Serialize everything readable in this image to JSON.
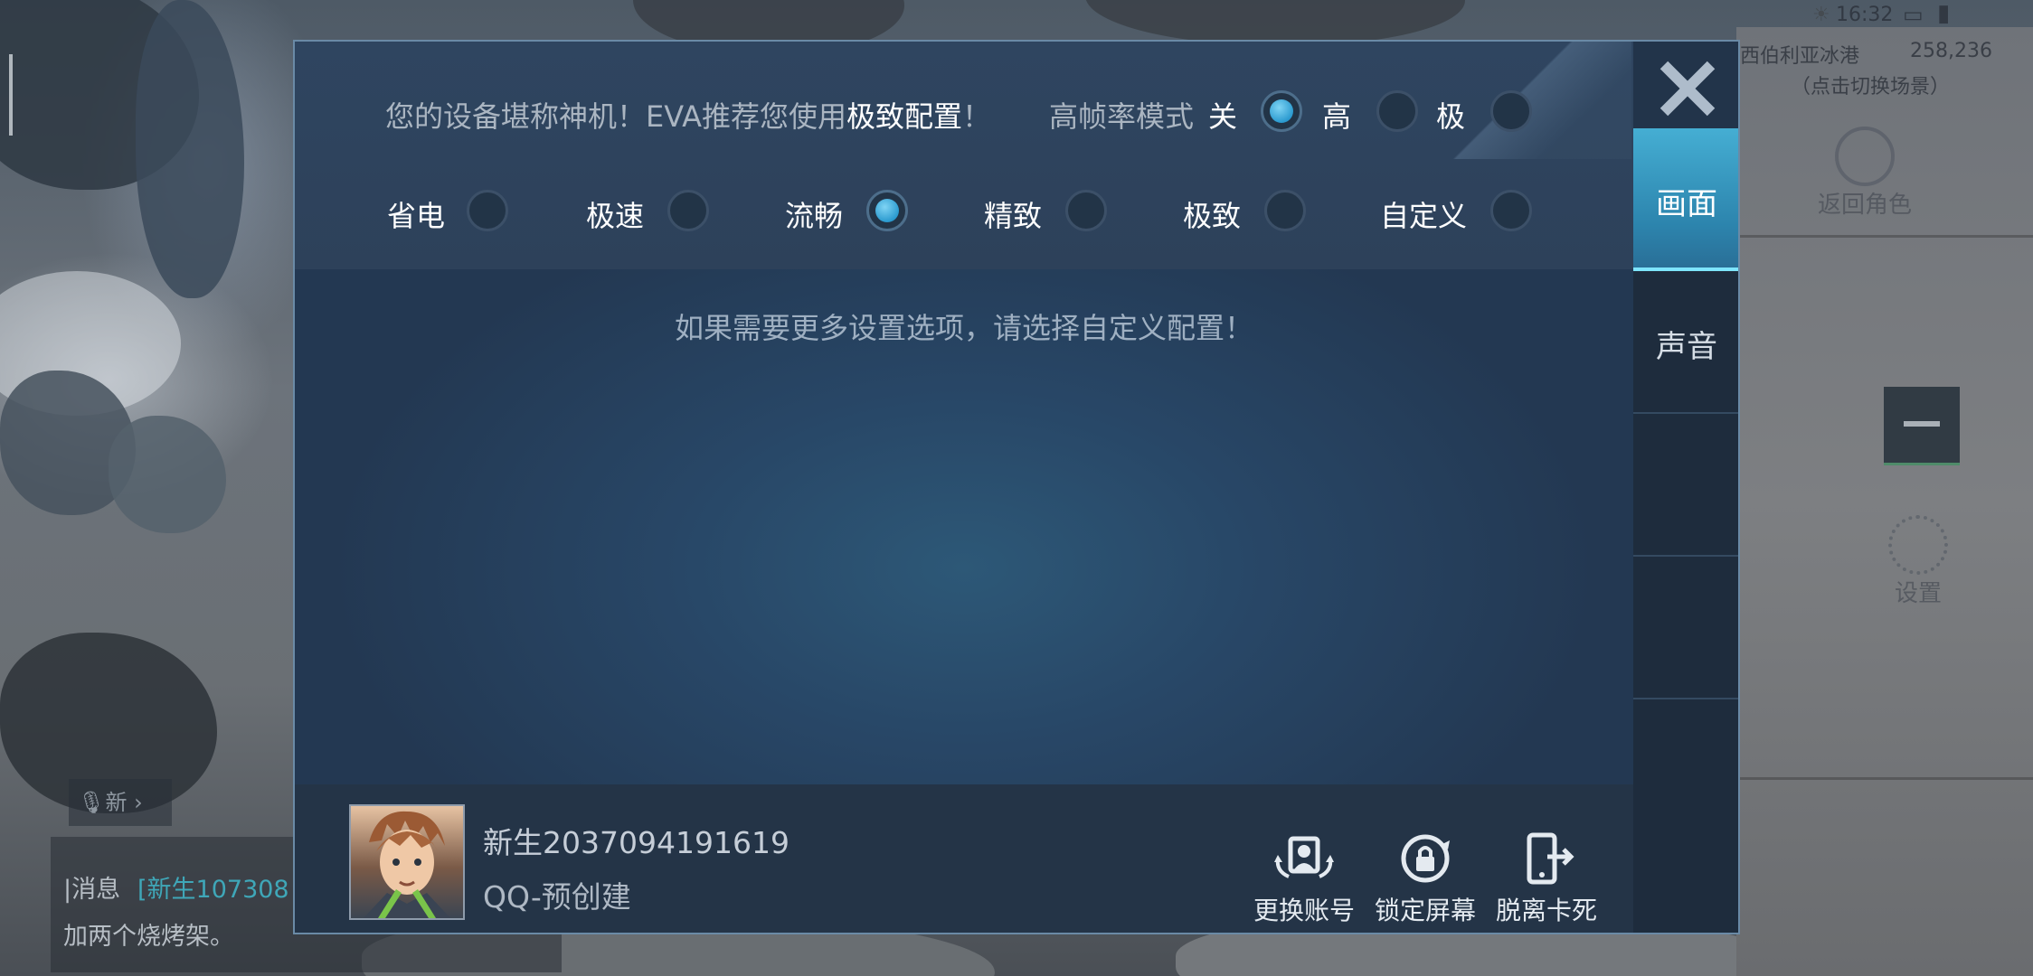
{
  "status_bar": {
    "time": "16:32"
  },
  "hud": {
    "location": "西伯利亚冰港",
    "coords": "258,236",
    "switch_hint": "（点击切换场景）",
    "return_role": "返回角色",
    "settings": "设置",
    "voice_label": "新",
    "chat_channel": "消息",
    "chat_sender": "[新生107308",
    "chat_text": "加两个烧烤架。"
  },
  "panel": {
    "recommend_prefix": "您的设备堪称神机！EVA推荐您使用",
    "recommend_highlight": "极致配置",
    "recommend_suffix": "！",
    "hfr_label": "高帧率模式",
    "hfr_options": [
      "关",
      "高",
      "极"
    ],
    "hfr_selected": "关",
    "quality_options": [
      "省电",
      "极速",
      "流畅",
      "精致",
      "极致",
      "自定义"
    ],
    "quality_selected": "流畅",
    "hint": "如果需要更多设置选项，请选择自定义配置！",
    "tabs": [
      "画面",
      "声音"
    ],
    "active_tab": "画面"
  },
  "account": {
    "name": "新生2037094191619",
    "platform": "QQ-预创建"
  },
  "actions": {
    "switch_account": "更换账号",
    "lock_screen": "锁定屏幕",
    "unstuck": "脱离卡死"
  },
  "colors": {
    "accent": "#2c9bd0",
    "tab_active": "#45aed3",
    "panel_bg": "#2b3e55"
  }
}
